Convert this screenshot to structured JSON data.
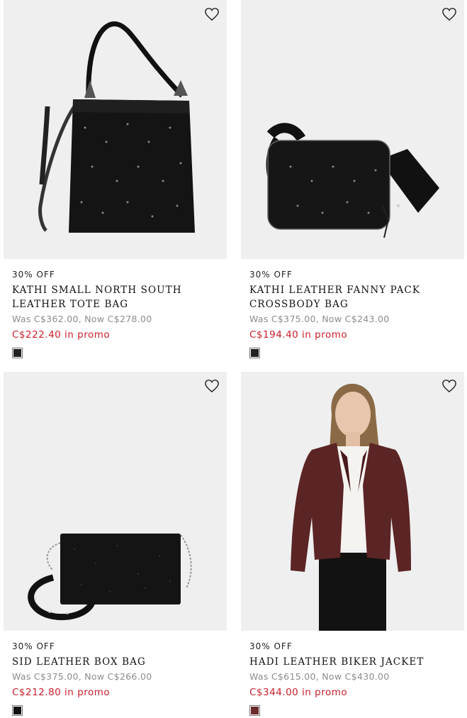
{
  "products": [
    {
      "promo": "30% OFF",
      "name": "KATHI SMALL NORTH SOUTH LEATHER TOTE BAG",
      "was_now": "Was C$362.00, Now C$278.00",
      "promo_price": "C$222.40 in promo",
      "swatch_color": "#222222",
      "image": "black studded leather tote bag"
    },
    {
      "promo": "30% OFF",
      "name": "KATHI LEATHER FANNY PACK CROSSBODY BAG",
      "was_now": "Was C$375.00, Now C$243.00",
      "promo_price": "C$194.40 in promo",
      "swatch_color": "#222222",
      "image": "black studded leather crossbody bag"
    },
    {
      "promo": "30% OFF",
      "name": "SID LEATHER BOX BAG",
      "was_now": "Was C$375.00, Now C$266.00",
      "promo_price": "C$212.80 in promo",
      "swatch_color": "#111111",
      "image": "black glitter leather box bag"
    },
    {
      "promo": "30% OFF",
      "name": "HADI LEATHER BIKER JACKET",
      "was_now": "Was C$615.00, Now C$430.00",
      "promo_price": "C$344.00 in promo",
      "swatch_color": "#6b2a2c",
      "image": "woman wearing burgundy leather biker jacket"
    }
  ],
  "icons": {
    "wishlist": "heart-outline-icon"
  },
  "colors": {
    "promo_red": "#c8202a",
    "muted": "#8c8c8c",
    "image_bg": "#efefef"
  }
}
